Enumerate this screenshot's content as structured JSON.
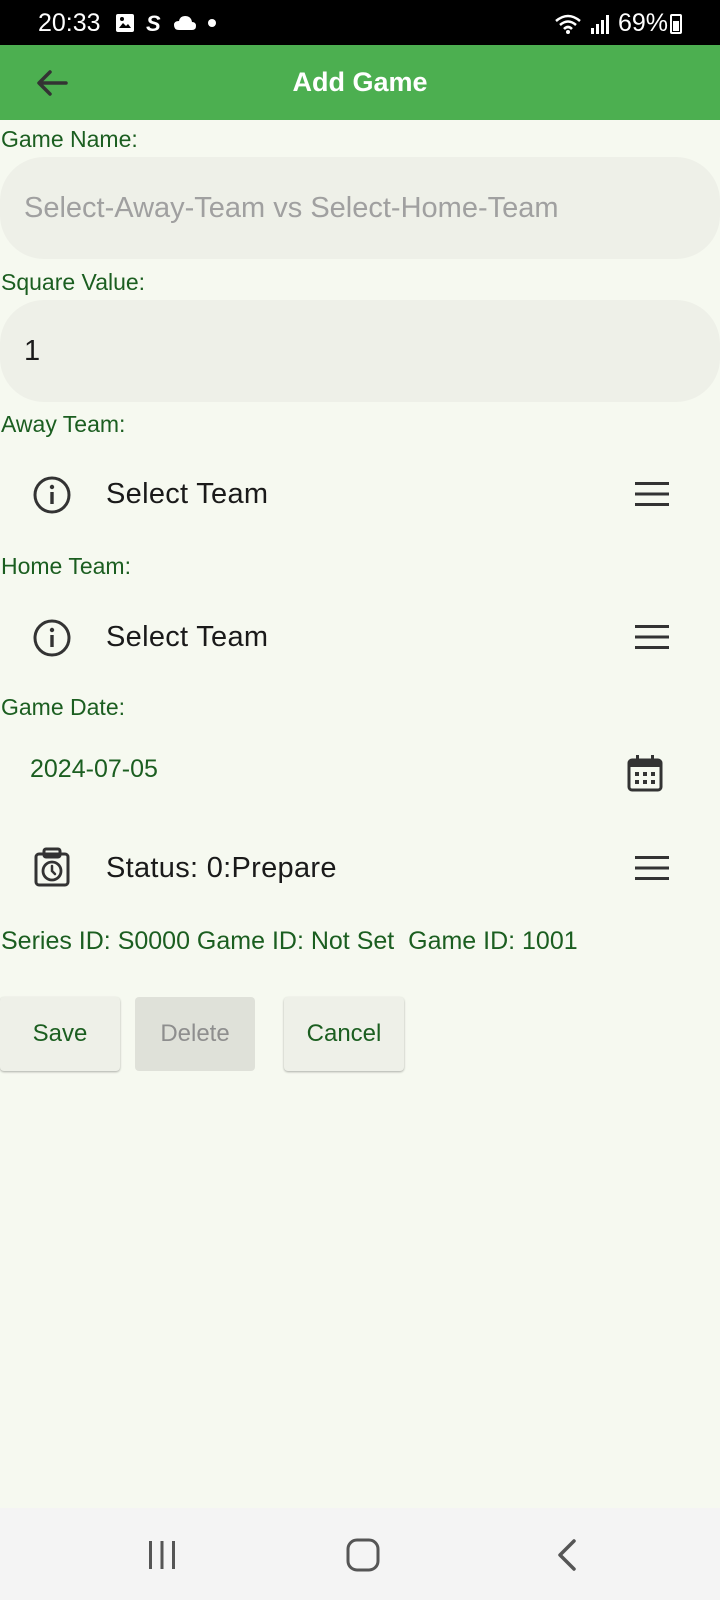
{
  "status_bar": {
    "time": "20:33",
    "battery": "69%"
  },
  "app_bar": {
    "title": "Add Game",
    "back_icon": "arrow-back-icon"
  },
  "form": {
    "game_name_label": "Game Name:",
    "game_name_placeholder": "Select-Away-Team vs Select-Home-Team",
    "square_value_label": "Square Value:",
    "square_value": "1",
    "away_team_label": "Away Team:",
    "away_team_value": "Select Team",
    "home_team_label": "Home Team:",
    "home_team_value": "Select Team",
    "game_date_label": "Game Date:",
    "game_date_value": "2024-07-05",
    "status_value": "Status: 0:Prepare",
    "ids_text": "Series ID: S0000 Game ID: Not Set  Game ID: 1001"
  },
  "buttons": {
    "save": "Save",
    "delete": "Delete",
    "cancel": "Cancel"
  },
  "colors": {
    "app_bar": "#4caf50",
    "label_green": "#1b5e20",
    "background": "#f6f9f0"
  }
}
